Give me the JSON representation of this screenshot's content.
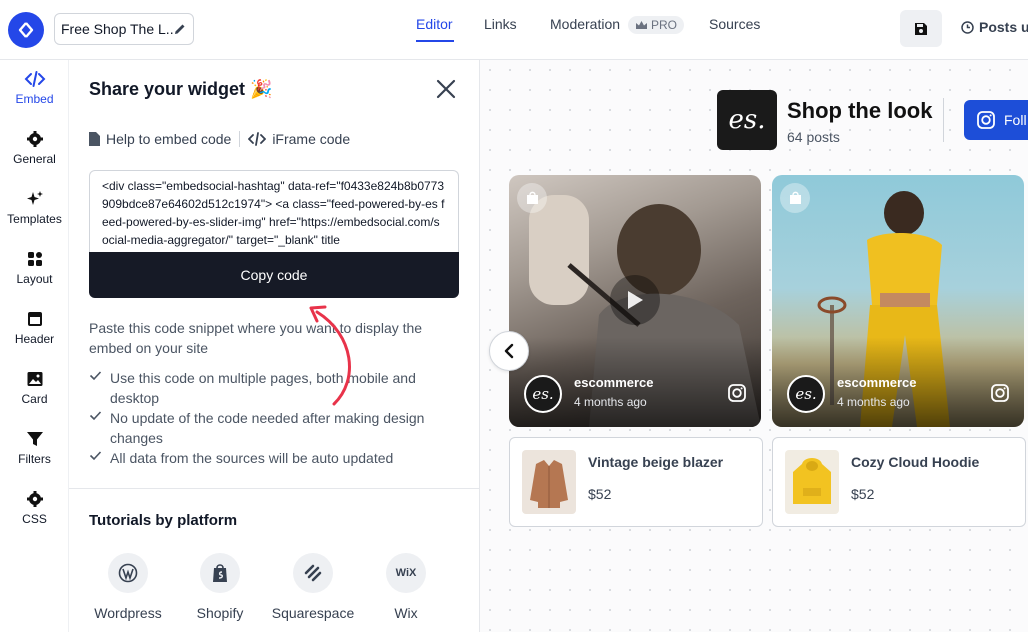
{
  "app": {
    "widget_title": "Free Shop The L...",
    "tabs": [
      "Editor",
      "Links",
      "Moderation",
      "Sources"
    ],
    "pro_badge": "PRO",
    "posts_label": "Posts u"
  },
  "sidebar": {
    "items": [
      {
        "label": "Embed",
        "icon": "code-icon"
      },
      {
        "label": "General",
        "icon": "gear-icon"
      },
      {
        "label": "Templates",
        "icon": "sparkle-icon"
      },
      {
        "label": "Layout",
        "icon": "layout-icon"
      },
      {
        "label": "Header",
        "icon": "header-icon"
      },
      {
        "label": "Card",
        "icon": "image-icon"
      },
      {
        "label": "Filters",
        "icon": "funnel-icon"
      },
      {
        "label": "CSS",
        "icon": "gear-icon"
      }
    ]
  },
  "panel": {
    "title": "Share your widget 🎉",
    "help_link": "Help to embed code",
    "iframe_link": "iFrame code",
    "code": "<div class=\"embedsocial-hashtag\" data-ref=\"f0433e824b8b0773909bdce87e64602d512c1974\"> <a class=\"feed-powered-by-es feed-powered-by-es-slider-img\" href=\"https://embedsocial.com/social-media-aggregator/\" target=\"_blank\" title",
    "copy_button": "Copy code",
    "instructions": "Paste this code snippet where you want to display the embed on your site",
    "checks": [
      "Use this code on multiple pages, both mobile and desktop",
      "No update of the code needed after making design changes",
      "All data from the sources will be auto updated"
    ],
    "tutorials_title": "Tutorials by platform",
    "platforms": [
      "Wordpress",
      "Shopify",
      "Squarespace",
      "Wix"
    ],
    "wix_icon_text": "WiX"
  },
  "preview": {
    "logo_text": "es.",
    "shop_title": "Shop the look",
    "post_count": "64 posts",
    "follow_label": "Foll",
    "posts": [
      {
        "username": "escommerce",
        "time": "4 months ago"
      },
      {
        "username": "escommerce",
        "time": "4 months ago"
      }
    ],
    "products": [
      {
        "name": "Vintage beige blazer",
        "price": "$52"
      },
      {
        "name": "Cozy Cloud Hoodie",
        "price": "$52"
      }
    ]
  },
  "colors": {
    "accent": "#2447e8",
    "dark_button": "#161a26",
    "annotation_arrow": "#e8334a"
  }
}
